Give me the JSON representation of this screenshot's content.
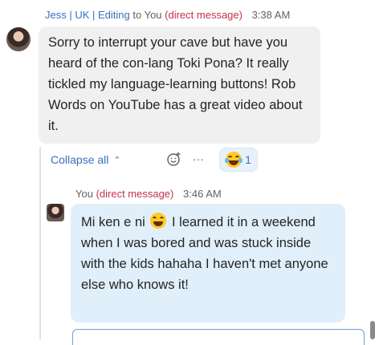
{
  "message1": {
    "sender": "Jess | UK | Editing",
    "to_text": "to You",
    "dm_label": "(direct message)",
    "time": "3:38 AM",
    "body": "Sorry to interrupt your cave but have you heard of the con-lang Toki Pona? It really tickled my language-learning buttons! Rob Words on YouTube has a great video about it."
  },
  "thread": {
    "collapse_label": "Collapse all",
    "more_label": "···",
    "reaction_count": "1",
    "reaction_icon": "joy-emoji-icon"
  },
  "message2": {
    "sender": "You",
    "dm_label": "(direct message)",
    "time": "3:46 AM",
    "body_before": "Mi ken e ni",
    "body_after": "I learned it in a weekend when I was bored and was stuck inside with the kids hahaha I haven't met anyone else who knows it!"
  },
  "colors": {
    "accent": "#3a6fbf",
    "dm_red": "#c4314b",
    "bubble_gray": "#f0f0f0",
    "bubble_blue": "#e0effa"
  }
}
